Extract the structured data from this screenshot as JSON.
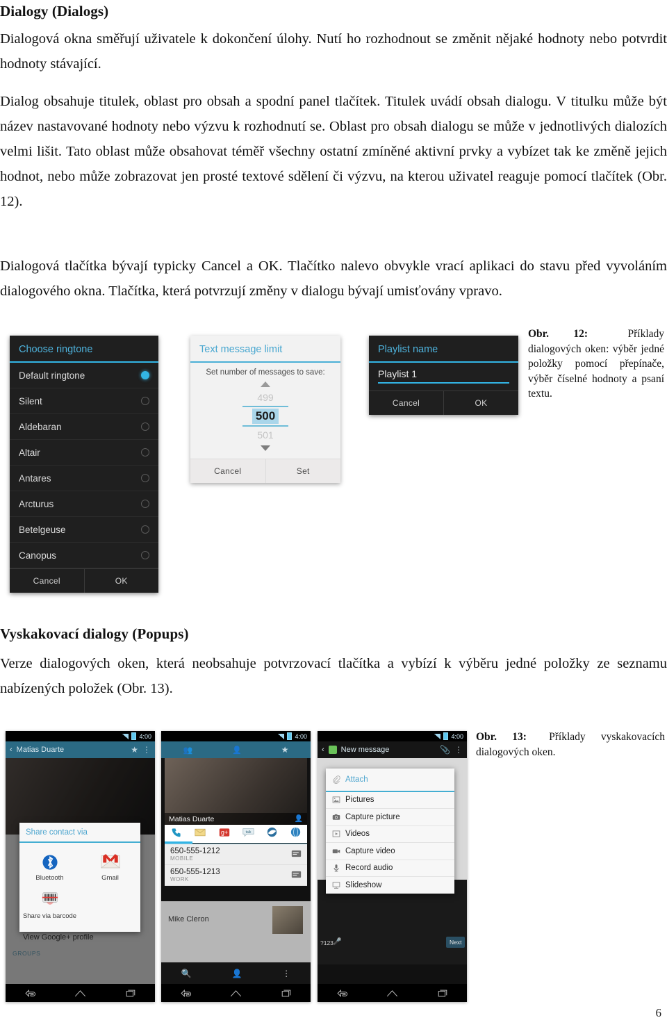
{
  "document": {
    "page_number": "6",
    "heading_1": "Dialogy (Dialogs)",
    "heading_2": "Vyskakovací dialogy (Popups)",
    "paragraphs": {
      "p1": "Dialogová okna směřují uživatele k dokončení úlohy. Nutí ho rozhodnout se změnit nějaké hodnoty nebo potvrdit hodnoty stávající.",
      "p2": "Dialog obsahuje titulek, oblast pro obsah a spodní panel tlačítek. Titulek uvádí obsah dialogu. V titulku může být název nastavované hodnoty nebo výzvu k rozhodnutí se. Oblast pro obsah dialogu se může v jednotlivých dialozích velmi lišit. Tato oblast může obsahovat téměř všechny ostatní zmíněné aktivní prvky a vybízet tak ke změně jejich hodnot, nebo může zobrazovat jen prosté textové sdělení či výzvu, na kterou uživatel reaguje pomocí tlačítek (Obr. 12).",
      "p3": "Dialogová tlačítka bývají typicky Cancel a OK. Tlačítko nalevo obvykle vrací aplikaci do stavu před vyvoláním dialogového okna. Tlačítka, která potvrzují změny v dialogu bývají umisťovány vpravo.",
      "p4": "Verze dialogových oken, která neobsahuje potvrzovací tlačítka a vybízí k výběru jedné položky ze seznamu nabízených položek (Obr. 13)."
    },
    "captions": {
      "fig12_label": "Obr. 12:",
      "fig12_text": "Příklady dialogových oken: výběr jedné položky pomocí přepínače, výběr číselné hodnoty a psaní textu.",
      "fig13_label": "Obr. 13:",
      "fig13_text": "Příklady vyskakovacích dialogových oken."
    }
  },
  "colors": {
    "accent_blue": "#33b5e5",
    "dialog_dark_bg": "#1f1f1f",
    "dialog_light_bg": "#f2f2f2",
    "action_bar_blue": "#2b6a84"
  },
  "figure12": {
    "ringtone_dialog": {
      "title": "Choose ringtone",
      "items": [
        {
          "label": "Default ringtone",
          "selected": true
        },
        {
          "label": "Silent",
          "selected": false
        },
        {
          "label": "Aldebaran",
          "selected": false
        },
        {
          "label": "Altair",
          "selected": false
        },
        {
          "label": "Antares",
          "selected": false
        },
        {
          "label": "Arcturus",
          "selected": false
        },
        {
          "label": "Betelgeuse",
          "selected": false
        },
        {
          "label": "Canopus",
          "selected": false
        }
      ],
      "cancel_label": "Cancel",
      "ok_label": "OK"
    },
    "number_dialog": {
      "title": "Text message limit",
      "prompt": "Set number of messages to save:",
      "value_above": "499",
      "value_current": "500",
      "value_below": "501",
      "cancel_label": "Cancel",
      "set_label": "Set"
    },
    "text_dialog": {
      "title": "Playlist name",
      "field_value": "Playlist 1",
      "cancel_label": "Cancel",
      "ok_label": "OK"
    }
  },
  "figure13": {
    "shot_share": {
      "status_time": "4:00",
      "actionbar_title": "Matias Duarte",
      "popup_title": "Share contact via",
      "targets": [
        {
          "label": "Bluetooth",
          "icon": "bluetooth-icon"
        },
        {
          "label": "Gmail",
          "icon": "gmail-icon"
        },
        {
          "label": "Share via barcode",
          "icon": "barcode-icon"
        }
      ],
      "background_row": "View Google+ profile",
      "background_section": "GROUPS"
    },
    "shot_contact": {
      "status_time": "4:00",
      "contact_name": "Matias Duarte",
      "tabs": [
        "phone-icon",
        "email-icon",
        "google-plus-icon",
        "talk-icon",
        "browser-icon",
        "globe-icon"
      ],
      "numbers": [
        {
          "number": "650-555-1212",
          "type": "MOBILE"
        },
        {
          "number": "650-555-1213",
          "type": "WORK"
        }
      ],
      "suggestion_name": "Mike Cleron"
    },
    "shot_attach": {
      "status_time": "4:00",
      "actionbar_title": "New message",
      "popup_title": "Attach",
      "items": [
        {
          "label": "Pictures",
          "icon": "picture-icon"
        },
        {
          "label": "Capture picture",
          "icon": "camera-icon"
        },
        {
          "label": "Videos",
          "icon": "video-icon"
        },
        {
          "label": "Capture video",
          "icon": "camcorder-icon"
        },
        {
          "label": "Record audio",
          "icon": "microphone-icon"
        },
        {
          "label": "Slideshow",
          "icon": "slideshow-icon"
        }
      ],
      "keyboard_sym_key": "?123",
      "keyboard_next_key": "Next"
    }
  }
}
